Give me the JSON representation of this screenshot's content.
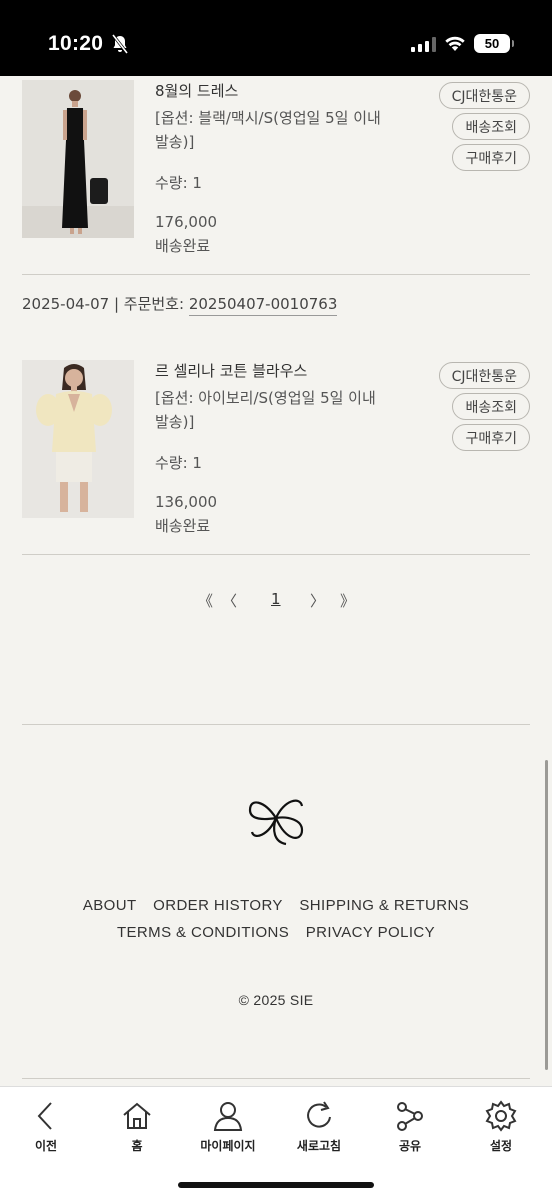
{
  "status_bar": {
    "time": "10:20",
    "battery": "50"
  },
  "orders": [
    {
      "name": "8월의 드레스",
      "option_line1": "[옵션: 블랙/맥시/S(영업일 5일 이내",
      "option_line2": "발송)]",
      "quantity": "수량: 1",
      "price": "176,000",
      "status": "배송완료",
      "buttons": {
        "carrier": "CJ대한통운",
        "tracking": "배송조회",
        "review": "구매후기"
      }
    },
    {
      "name": "르 셀리나 코튼 블라우스",
      "option_line1": "[옵션: 아이보리/S(영업일 5일 이내",
      "option_line2": "발송)]",
      "quantity": "수량: 1",
      "price": "136,000",
      "status": "배송완료",
      "buttons": {
        "carrier": "CJ대한통운",
        "tracking": "배송조회",
        "review": "구매후기"
      }
    }
  ],
  "order_header": {
    "date": "2025-04-07",
    "separator": " | ",
    "number_label": "주문번호: ",
    "number": "20250407-0010763"
  },
  "pagination": {
    "first": "《",
    "prev": "〈",
    "current": "1",
    "next": "〉",
    "last": "》"
  },
  "footer": {
    "links_row1": [
      "ABOUT",
      "ORDER HISTORY",
      "SHIPPING & RETURNS"
    ],
    "links_row2": [
      "TERMS & CONDITIONS",
      "PRIVACY POLICY"
    ],
    "copyright": "© 2025 SIE"
  },
  "bottom_nav": [
    {
      "label": "이전",
      "icon": "back-icon"
    },
    {
      "label": "홈",
      "icon": "home-icon"
    },
    {
      "label": "마이페이지",
      "icon": "user-icon"
    },
    {
      "label": "새로고침",
      "icon": "refresh-icon"
    },
    {
      "label": "공유",
      "icon": "share-icon"
    },
    {
      "label": "설정",
      "icon": "gear-icon"
    }
  ]
}
